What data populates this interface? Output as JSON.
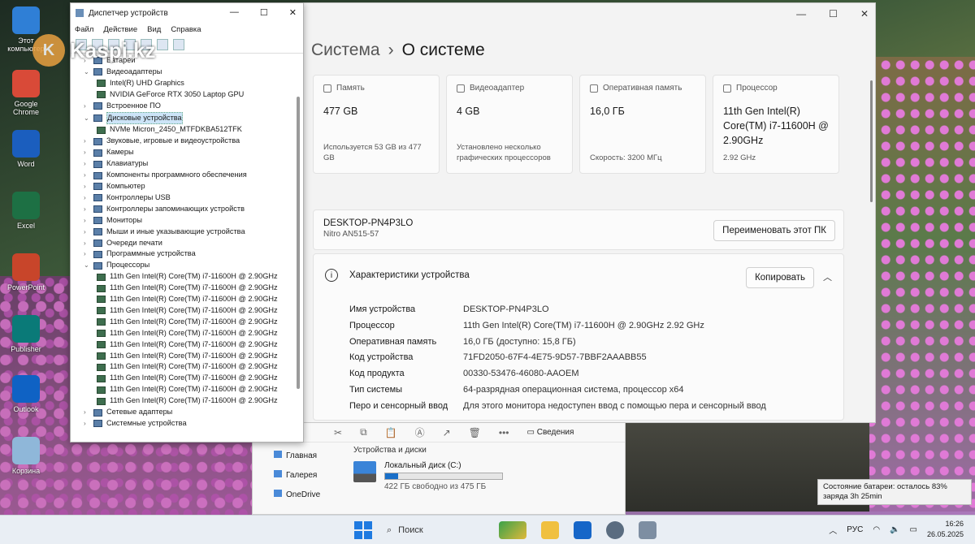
{
  "watermark": {
    "text": "Kaspi.kz"
  },
  "desktop_icons": [
    {
      "label": "Этот компьютер",
      "color": "#2f7fd6",
      "icon": "computer-icon"
    },
    {
      "label": "Google Chrome",
      "color": "#d94a38",
      "icon": "chrome-icon"
    },
    {
      "label": "Word",
      "color": "#1b5ebe",
      "icon": "word-icon"
    },
    {
      "label": "Excel",
      "color": "#1d7044",
      "icon": "excel-icon"
    },
    {
      "label": "PowerPoint",
      "color": "#c8452a",
      "icon": "powerpoint-icon"
    },
    {
      "label": "Publisher",
      "color": "#0a7a78",
      "icon": "publisher-icon"
    },
    {
      "label": "Outlook",
      "color": "#0f62c4",
      "icon": "outlook-icon"
    },
    {
      "label": "Корзина",
      "color": "#8fb7d9",
      "icon": "recycle-bin-icon"
    }
  ],
  "settings": {
    "breadcrumb_parent": "Система",
    "breadcrumb_current": "О системе",
    "cards": [
      {
        "label": "Память",
        "value": "477 GB",
        "sub": "Используется 53 GB из 477 GB"
      },
      {
        "label": "Видеоадаптер",
        "value": "4 GB",
        "sub": "Установлено несколько графических процессоров"
      },
      {
        "label": "Оперативная память",
        "value": "16,0 ГБ",
        "sub": "Скорость: 3200 МГц"
      },
      {
        "label": "Процессор",
        "value": "11th Gen Intel(R) Core(TM) i7-11600H @ 2.90GHz",
        "sub": "2.92 GHz"
      }
    ],
    "pc_name": "DESKTOP-PN4P3LO",
    "pc_model": "Nitro AN515-57",
    "rename_button": "Переименовать этот ПК",
    "specs_title": "Характеристики устройства",
    "copy_button": "Копировать",
    "spec_rows": [
      {
        "k": "Имя устройства",
        "v": "DESKTOP-PN4P3LO"
      },
      {
        "k": "Процессор",
        "v": "11th Gen Intel(R) Core(TM) i7-11600H @ 2.90GHz   2.92 GHz"
      },
      {
        "k": "Оперативная память",
        "v": "16,0 ГБ (доступно: 15,8 ГБ)"
      },
      {
        "k": "Код устройства",
        "v": "71FD2050-67F4-4E75-9D57-7BBF2AAABB55"
      },
      {
        "k": "Код продукта",
        "v": "00330-53476-46080-AAOEM"
      },
      {
        "k": "Тип системы",
        "v": "64-разрядная операционная система, процессор x64"
      },
      {
        "k": "Перо и сенсорный ввод",
        "v": "Для этого монитора недоступен ввод с помощью пера и сенсорный ввод"
      }
    ]
  },
  "devmgr": {
    "title": "Диспетчер устройств",
    "menu": [
      "Файл",
      "Действие",
      "Вид",
      "Справка"
    ],
    "tree": [
      {
        "t": "Батареи",
        "lvl": 1,
        "arr": "›"
      },
      {
        "t": "Видеоадаптеры",
        "lvl": 1,
        "arr": "⌄"
      },
      {
        "t": "Intel(R) UHD Graphics",
        "lvl": 2
      },
      {
        "t": "NVIDIA GeForce RTX 3050 Laptop GPU",
        "lvl": 2
      },
      {
        "t": "Встроенное ПО",
        "lvl": 1,
        "arr": "›"
      },
      {
        "t": "Дисковые устройства",
        "lvl": 1,
        "arr": "⌄",
        "sel": true
      },
      {
        "t": "NVMe Micron_2450_MTFDKBA512TFK",
        "lvl": 2
      },
      {
        "t": "Звуковые, игровые и видеоустройства",
        "lvl": 1,
        "arr": "›"
      },
      {
        "t": "Камеры",
        "lvl": 1,
        "arr": "›"
      },
      {
        "t": "Клавиатуры",
        "lvl": 1,
        "arr": "›"
      },
      {
        "t": "Компоненты программного обеспечения",
        "lvl": 1,
        "arr": "›"
      },
      {
        "t": "Компьютер",
        "lvl": 1,
        "arr": "›"
      },
      {
        "t": "Контроллеры USB",
        "lvl": 1,
        "arr": "›"
      },
      {
        "t": "Контроллеры запоминающих устройств",
        "lvl": 1,
        "arr": "›"
      },
      {
        "t": "Мониторы",
        "lvl": 1,
        "arr": "›"
      },
      {
        "t": "Мыши и иные указывающие устройства",
        "lvl": 1,
        "arr": "›"
      },
      {
        "t": "Очереди печати",
        "lvl": 1,
        "arr": "›"
      },
      {
        "t": "Программные устройства",
        "lvl": 1,
        "arr": "›"
      },
      {
        "t": "Процессоры",
        "lvl": 1,
        "arr": "⌄"
      },
      {
        "t": "11th Gen Intel(R) Core(TM) i7-11600H @ 2.90GHz",
        "lvl": 2
      },
      {
        "t": "11th Gen Intel(R) Core(TM) i7-11600H @ 2.90GHz",
        "lvl": 2
      },
      {
        "t": "11th Gen Intel(R) Core(TM) i7-11600H @ 2.90GHz",
        "lvl": 2
      },
      {
        "t": "11th Gen Intel(R) Core(TM) i7-11600H @ 2.90GHz",
        "lvl": 2
      },
      {
        "t": "11th Gen Intel(R) Core(TM) i7-11600H @ 2.90GHz",
        "lvl": 2
      },
      {
        "t": "11th Gen Intel(R) Core(TM) i7-11600H @ 2.90GHz",
        "lvl": 2
      },
      {
        "t": "11th Gen Intel(R) Core(TM) i7-11600H @ 2.90GHz",
        "lvl": 2
      },
      {
        "t": "11th Gen Intel(R) Core(TM) i7-11600H @ 2.90GHz",
        "lvl": 2
      },
      {
        "t": "11th Gen Intel(R) Core(TM) i7-11600H @ 2.90GHz",
        "lvl": 2
      },
      {
        "t": "11th Gen Intel(R) Core(TM) i7-11600H @ 2.90GHz",
        "lvl": 2
      },
      {
        "t": "11th Gen Intel(R) Core(TM) i7-11600H @ 2.90GHz",
        "lvl": 2
      },
      {
        "t": "11th Gen Intel(R) Core(TM) i7-11600H @ 2.90GHz",
        "lvl": 2
      },
      {
        "t": "Сетевые адаптеры",
        "lvl": 1,
        "arr": "›"
      },
      {
        "t": "Системные устройства",
        "lvl": 1,
        "arr": "›"
      }
    ]
  },
  "explorer": {
    "details": "Сведения",
    "nav": [
      "Главная",
      "Галерея",
      "OneDrive"
    ],
    "section": "Устройства и диски",
    "drive_name": "Локальный диск (C:)",
    "drive_free": "422 ГБ свободно из 475 ГБ",
    "drive_used_fraction": 0.11
  },
  "tooltip": "Состояние батареи: осталось 83% заряда 3h 25min",
  "taskbar": {
    "search": "Поиск",
    "lang": "РУС",
    "time": "16:26",
    "date": "26.05.2025"
  }
}
